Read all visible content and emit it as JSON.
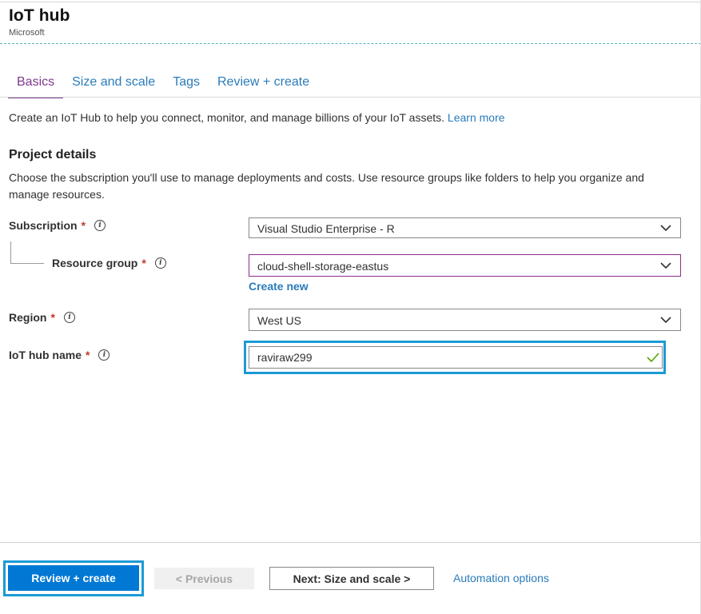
{
  "header": {
    "title": "IoT hub",
    "subtitle": "Microsoft"
  },
  "tabs": [
    {
      "label": "Basics",
      "active": true
    },
    {
      "label": "Size and scale",
      "active": false
    },
    {
      "label": "Tags",
      "active": false
    },
    {
      "label": "Review + create",
      "active": false
    }
  ],
  "intro": {
    "text": "Create an IoT Hub to help you connect, monitor, and manage billions of your IoT assets.",
    "link": "Learn more"
  },
  "project": {
    "title": "Project details",
    "description": "Choose the subscription you'll use to manage deployments and costs. Use resource groups like folders to help you organize and manage resources."
  },
  "fields": {
    "subscription": {
      "label": "Subscription",
      "required": "*",
      "value": "Visual Studio Enterprise - R"
    },
    "resource_group": {
      "label": "Resource group",
      "required": "*",
      "value": "cloud-shell-storage-eastus",
      "create_new": "Create new"
    },
    "region": {
      "label": "Region",
      "required": "*",
      "value": "West US"
    },
    "hub_name": {
      "label": "IoT hub name",
      "required": "*",
      "value": "raviraw299"
    }
  },
  "icons": {
    "info": "i",
    "chevron": "chevron-down-icon",
    "valid": "checkmark-icon"
  },
  "footer": {
    "review_create": "Review + create",
    "previous": "< Previous",
    "next": "Next: Size and scale >",
    "automation": "Automation options"
  },
  "colors": {
    "accent": "#0078d4",
    "link": "#2a7cba",
    "active_tab": "#7d3a8c",
    "highlight": "#1b9ad6",
    "required": "#c0392b",
    "valid": "#57a300"
  }
}
